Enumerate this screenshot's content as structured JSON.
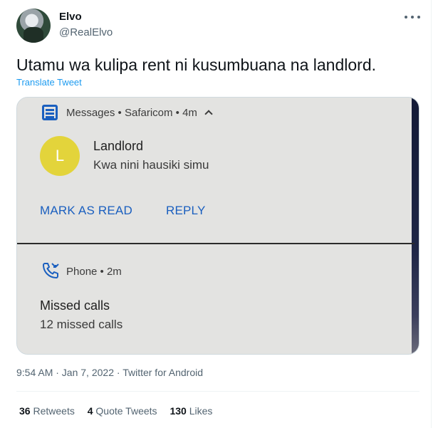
{
  "author": {
    "display_name": "Elvo",
    "handle": "@RealElvo"
  },
  "tweet": {
    "text": "Utamu wa kulipa rent ni kusumbuana na landlord.",
    "translate_label": "Translate Tweet",
    "time": "9:54 AM · Jan 7, 2022",
    "source": "Twitter for Android"
  },
  "screenshot": {
    "message_notification": {
      "app": "Messages",
      "carrier": "Safaricom",
      "age": "4m",
      "contact_initial": "L",
      "sender": "Landlord",
      "message": "Kwa nini hausiki simu",
      "actions": {
        "mark_read": "MARK AS READ",
        "reply": "REPLY"
      }
    },
    "phone_notification": {
      "app": "Phone",
      "age": "2m",
      "title": "Missed calls",
      "subtitle": "12 missed calls"
    }
  },
  "stats": {
    "retweets": {
      "count": "36",
      "label": "Retweets"
    },
    "quotes": {
      "count": "4",
      "label": "Quote Tweets"
    },
    "likes": {
      "count": "130",
      "label": "Likes"
    }
  },
  "colors": {
    "link": "#1d9bf0",
    "android_blue": "#1a5fbf",
    "contact_yellow": "#e3d43b"
  },
  "icons": [
    "more-icon",
    "messages-icon",
    "chevron-up-icon",
    "missed-call-icon"
  ]
}
